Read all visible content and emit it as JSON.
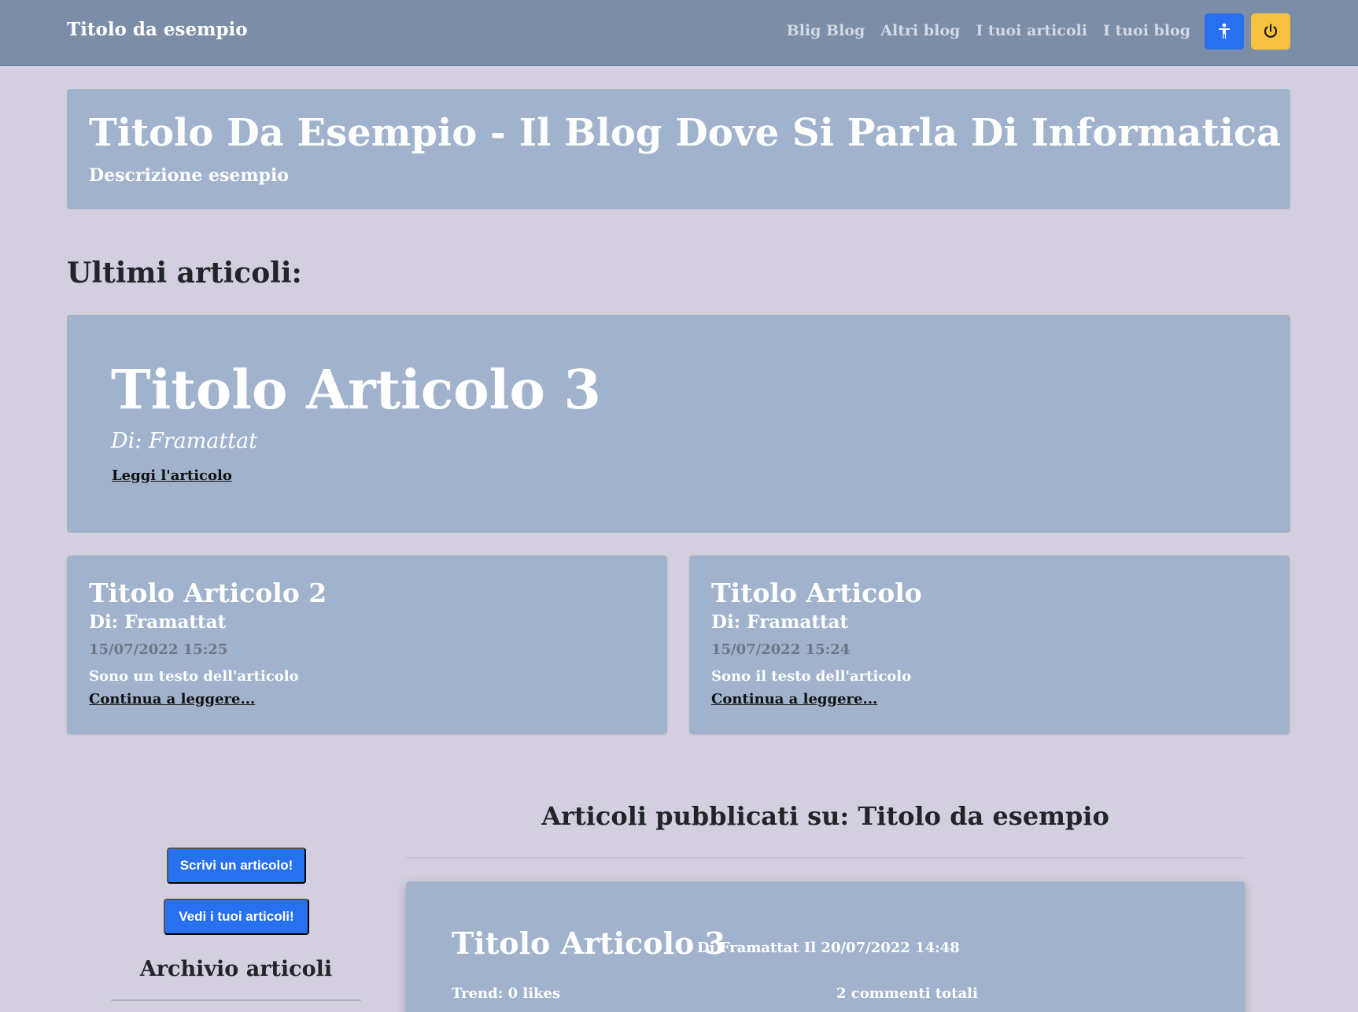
{
  "navbar": {
    "brand": "Titolo da esempio",
    "links": [
      "Blig Blog",
      "Altri blog",
      "I tuoi articoli",
      "I tuoi blog"
    ],
    "accessibility_icon": "accessibility-person-icon",
    "power_icon": "power-icon"
  },
  "header": {
    "title": "Titolo Da Esempio - Il Blog Dove Si Parla Di Informatica",
    "description": "Descrizione esempio"
  },
  "latest": {
    "section_title": "Ultimi articoli:",
    "featured": {
      "title": "Titolo Articolo 3",
      "author": "Di: Framattat",
      "link": "Leggi l'articolo"
    },
    "cards": [
      {
        "title": "Titolo Articolo 2",
        "author": "Di: Framattat",
        "date": "15/07/2022 15:25",
        "text": "Sono un testo dell'articolo",
        "link": "Continua a leggere..."
      },
      {
        "title": "Titolo Articolo",
        "author": "Di: Framattat",
        "date": "15/07/2022 15:24",
        "text": "Sono il testo dell'articolo",
        "link": "Continua a leggere..."
      }
    ]
  },
  "sidebar": {
    "write_button": "Scrivi un articolo!",
    "view_button": "Vedi i tuoi articoli!",
    "archive_title": "Archivio articoli"
  },
  "main": {
    "title": "Articoli pubblicati su: Titolo da esempio",
    "post": {
      "title": "Titolo Articolo 3",
      "meta": "Di Framattat Il 20/07/2022 14:48",
      "trend": "Trend: 0 likes",
      "comments": "2 commenti totali"
    }
  },
  "colors": {
    "navbar": "#7b8da7",
    "card": "#a1b3cc",
    "background": "#d4cfdf",
    "primary": "#2770ef",
    "warning": "#f7c23f"
  }
}
